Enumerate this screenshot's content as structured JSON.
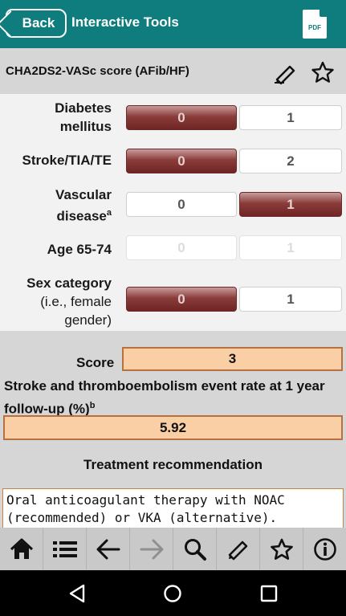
{
  "header": {
    "back_label": "Back",
    "title": "Interactive Tools",
    "pdf_label": "PDF"
  },
  "subheader": {
    "calculator_title": "CHA2DS2-VASc score (AFib/HF)",
    "edit_icon": "pencil-icon",
    "favorite_icon": "star-outline-icon"
  },
  "params": [
    {
      "label_line1": "Diabetes",
      "label_line2": "mellitus",
      "options": [
        "0",
        "1"
      ],
      "selected": 0,
      "enabled": true
    },
    {
      "label_line1": "Stroke/TIA/TE",
      "options": [
        "0",
        "2"
      ],
      "selected": 0,
      "enabled": true
    },
    {
      "label_line1": "Vascular",
      "label_line2": "disease",
      "label_sup": "a",
      "options": [
        "0",
        "1"
      ],
      "selected": 1,
      "enabled": true
    },
    {
      "label_line1": "Age 65-74",
      "options": [
        "0",
        "1"
      ],
      "selected": null,
      "enabled": false
    },
    {
      "label_line1": "Sex category",
      "label_line2": "(i.e., female",
      "label_line3": "gender)",
      "options": [
        "0",
        "1"
      ],
      "selected": 0,
      "enabled": true
    }
  ],
  "results": {
    "score_label": "Score",
    "score_value": "3",
    "event_rate_label": "Stroke and thromboembolism event rate at 1 year follow-up (%)",
    "event_rate_sup": "b",
    "event_rate_value": "5.92",
    "treatment_label": "Treatment recommendation",
    "treatment_text": "Oral anticoagulant therapy with NOAC (recommended) or VKA (alternative)."
  },
  "toolbar": {
    "icons": [
      "home-icon",
      "list-icon",
      "back-arrow-icon",
      "forward-arrow-icon",
      "search-icon",
      "pencil-icon",
      "star-icon",
      "info-icon"
    ]
  },
  "android_nav": {
    "icons": [
      "nav-back-icon",
      "nav-home-icon",
      "nav-recents-icon"
    ]
  },
  "colors": {
    "header_bg": "#0f7d7e",
    "selected_option": "#7a2e2d",
    "result_fill": "#fbcfa6",
    "result_border": "#b9703f"
  }
}
